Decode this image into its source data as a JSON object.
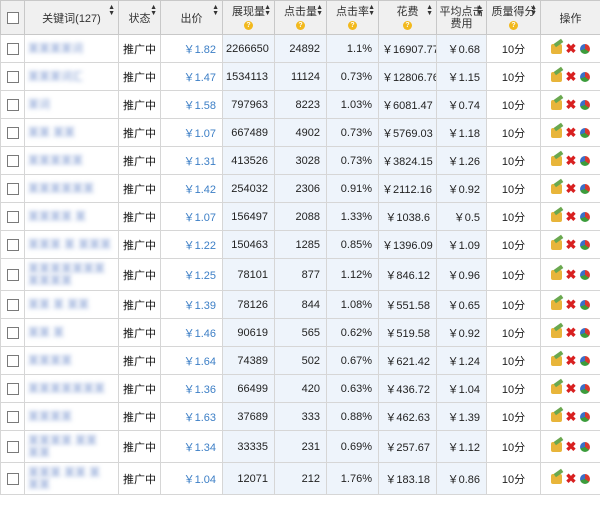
{
  "header": {
    "keyword": "关键词(127)",
    "status": "状态",
    "bid": "出价",
    "impressions": "展现量",
    "clicks": "点击量",
    "ctr": "点击率",
    "cost": "花费",
    "avg_cost_line1": "平均点击",
    "avg_cost_line2": "费用",
    "quality": "质量得分",
    "ops": "操作",
    "help_mark": "?"
  },
  "icons": {
    "edit": "edit-icon",
    "delete": "delete-icon",
    "report": "pie-chart-icon",
    "sort": "sort-arrows-icon",
    "help": "question-icon"
  },
  "rows": [
    {
      "keyword": "某某某某词",
      "status": "推广中",
      "bid": "￥1.82",
      "impressions": "2266650",
      "clicks": "24892",
      "ctr": "1.1%",
      "cost": "￥16907.77",
      "avg": "￥0.68",
      "quality": "10分"
    },
    {
      "keyword": "某某某词汇",
      "status": "推广中",
      "bid": "￥1.47",
      "impressions": "1534113",
      "clicks": "11124",
      "ctr": "0.73%",
      "cost": "￥12806.76",
      "avg": "￥1.15",
      "quality": "10分"
    },
    {
      "keyword": "某词",
      "status": "推广中",
      "bid": "￥1.58",
      "impressions": "797963",
      "clicks": "8223",
      "ctr": "1.03%",
      "cost": "￥6081.47",
      "avg": "￥0.74",
      "quality": "10分"
    },
    {
      "keyword": "某某 某某",
      "status": "推广中",
      "bid": "￥1.07",
      "impressions": "667489",
      "clicks": "4902",
      "ctr": "0.73%",
      "cost": "￥5769.03",
      "avg": "￥1.18",
      "quality": "10分"
    },
    {
      "keyword": "某某某某某",
      "status": "推广中",
      "bid": "￥1.31",
      "impressions": "413526",
      "clicks": "3028",
      "ctr": "0.73%",
      "cost": "￥3824.15",
      "avg": "￥1.26",
      "quality": "10分"
    },
    {
      "keyword": "某某某某某某",
      "status": "推广中",
      "bid": "￥1.42",
      "impressions": "254032",
      "clicks": "2306",
      "ctr": "0.91%",
      "cost": "￥2112.16",
      "avg": "￥0.92",
      "quality": "10分"
    },
    {
      "keyword": "某某某某 某",
      "status": "推广中",
      "bid": "￥1.07",
      "impressions": "156497",
      "clicks": "2088",
      "ctr": "1.33%",
      "cost": "￥1038.6",
      "avg": "￥0.5",
      "quality": "10分"
    },
    {
      "keyword": "某某某 某 某某某",
      "status": "推广中",
      "bid": "￥1.22",
      "impressions": "150463",
      "clicks": "1285",
      "ctr": "0.85%",
      "cost": "￥1396.09",
      "avg": "￥1.09",
      "quality": "10分"
    },
    {
      "keyword": "某某某某某某某",
      "keyword2": "某某某某",
      "status": "推广中",
      "bid": "￥1.25",
      "impressions": "78101",
      "clicks": "877",
      "ctr": "1.12%",
      "cost": "￥846.12",
      "avg": "￥0.96",
      "quality": "10分"
    },
    {
      "keyword": "某某 某 某某",
      "status": "推广中",
      "bid": "￥1.39",
      "impressions": "78126",
      "clicks": "844",
      "ctr": "1.08%",
      "cost": "￥551.58",
      "avg": "￥0.65",
      "quality": "10分"
    },
    {
      "keyword": "某某 某",
      "status": "推广中",
      "bid": "￥1.46",
      "impressions": "90619",
      "clicks": "565",
      "ctr": "0.62%",
      "cost": "￥519.58",
      "avg": "￥0.92",
      "quality": "10分"
    },
    {
      "keyword": "某某某某",
      "status": "推广中",
      "bid": "￥1.64",
      "impressions": "74389",
      "clicks": "502",
      "ctr": "0.67%",
      "cost": "￥621.42",
      "avg": "￥1.24",
      "quality": "10分"
    },
    {
      "keyword": "某某某某某某某",
      "status": "推广中",
      "bid": "￥1.36",
      "impressions": "66499",
      "clicks": "420",
      "ctr": "0.63%",
      "cost": "￥436.72",
      "avg": "￥1.04",
      "quality": "10分"
    },
    {
      "keyword": "某某某某",
      "status": "推广中",
      "bid": "￥1.63",
      "impressions": "37689",
      "clicks": "333",
      "ctr": "0.88%",
      "cost": "￥462.63",
      "avg": "￥1.39",
      "quality": "10分"
    },
    {
      "keyword": "某某某某 某某",
      "keyword2": "某某",
      "status": "推广中",
      "bid": "￥1.34",
      "impressions": "33335",
      "clicks": "231",
      "ctr": "0.69%",
      "cost": "￥257.67",
      "avg": "￥1.12",
      "quality": "10分"
    },
    {
      "keyword": "某某某 某某 某",
      "keyword2": "某某",
      "status": "推广中",
      "bid": "￥1.04",
      "impressions": "12071",
      "clicks": "212",
      "ctr": "1.76%",
      "cost": "￥183.18",
      "avg": "￥0.86",
      "quality": "10分"
    }
  ]
}
